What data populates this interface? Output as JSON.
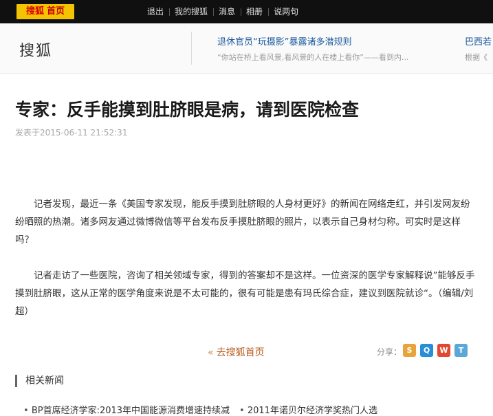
{
  "topbar": {
    "brand_name": "搜狐",
    "brand_home": "首页",
    "nav": [
      "退出",
      "我的搜狐",
      "消息",
      "相册",
      "说两句"
    ]
  },
  "header": {
    "logo": "搜狐",
    "news": [
      {
        "title": "退休官员“玩摄影”暴露诸多潜规则",
        "sub": "“你站在桥上看风景,看风景的人在楼上看你”——看到内..."
      },
      {
        "title": "巴西若",
        "sub": "根据《"
      }
    ]
  },
  "article": {
    "title": "专家：反手能摸到肚脐眼是病，请到医院检查",
    "meta": "发表于2015-06-11 21:52:31",
    "paragraphs": [
      "记者发现，最近一条《美国专家发现，能反手摸到肚脐眼的人身材更好》的新闻在网络走红，并引发网友纷纷晒照的热潮。诸多网友通过微博微信等平台发布反手摸肚脐眼的照片，以表示自己身材匀称。可实时是这样吗？",
      "记者走访了一些医院，咨询了相关领域专家，得到的答案却不是这样。一位资深的医学专家解释说”能够反手摸到肚脐眼，这从正常的医学角度来说是不太可能的，很有可能是患有玛氏综合症，建议到医院就诊“。（编辑/刘超）"
    ]
  },
  "footer": {
    "back_arrow": "«",
    "back_label": "去搜狐首页",
    "share_label": "分享：",
    "share_icons": [
      {
        "name": "sohu-share-icon",
        "color": "#e8a33a",
        "glyph": "S"
      },
      {
        "name": "qq-share-icon",
        "color": "#2a8ed6",
        "glyph": "Q"
      },
      {
        "name": "weibo-share-icon",
        "color": "#e2472f",
        "glyph": "W"
      },
      {
        "name": "tencent-weibo-share-icon",
        "color": "#5aa7d8",
        "glyph": "T"
      }
    ]
  },
  "related": {
    "heading": "相关新闻",
    "items": [
      "BP首席经济学家:2013年中国能源消费增速持续减",
      "2011年诺贝尔经济学奖热门人选"
    ]
  }
}
